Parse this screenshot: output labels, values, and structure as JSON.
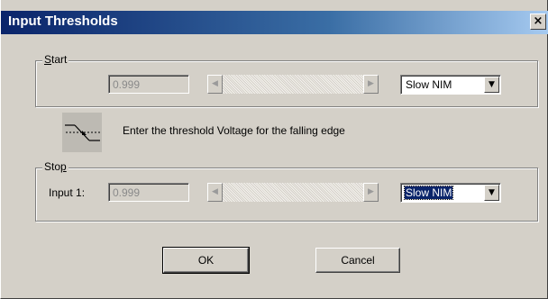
{
  "window": {
    "title": "Input Thresholds",
    "close_glyph": "×"
  },
  "start_group": {
    "legend_mnemonic": "S",
    "legend_rest": "tart",
    "value": "0.999",
    "standard": "Slow NIM"
  },
  "hint": {
    "icon": "falling-edge-threshold-icon",
    "text": "Enter the threshold Voltage for the falling edge"
  },
  "stop_group": {
    "legend_prefix": "Sto",
    "legend_mnemonic": "p",
    "input_label": "Input 1:",
    "value": "0.999",
    "standard": "Slow NIM"
  },
  "buttons": {
    "ok": "OK",
    "cancel": "Cancel"
  },
  "glyphs": {
    "arrow_left": "◀",
    "arrow_right": "▶",
    "dropdown": "▼"
  },
  "colors": {
    "face": "#d4d0c8",
    "title_start": "#0a246a",
    "title_end": "#a6caf0",
    "selection": "#0a246a"
  }
}
